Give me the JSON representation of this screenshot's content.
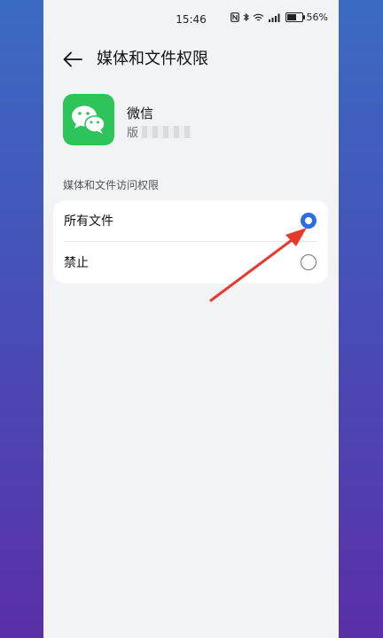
{
  "status_bar": {
    "time": "15:46",
    "battery": "56%",
    "battery_level": 0.56
  },
  "header": {
    "title": "媒体和文件权限"
  },
  "app": {
    "name": "微信",
    "version_prefix": "版"
  },
  "section": {
    "label": "媒体和文件访问权限"
  },
  "options": [
    {
      "label": "所有文件",
      "selected": true
    },
    {
      "label": "禁止",
      "selected": false
    }
  ],
  "colors": {
    "accent": "#2a6ee6",
    "app_icon": "#2dc45a",
    "annotation_arrow": "#e8392f"
  }
}
